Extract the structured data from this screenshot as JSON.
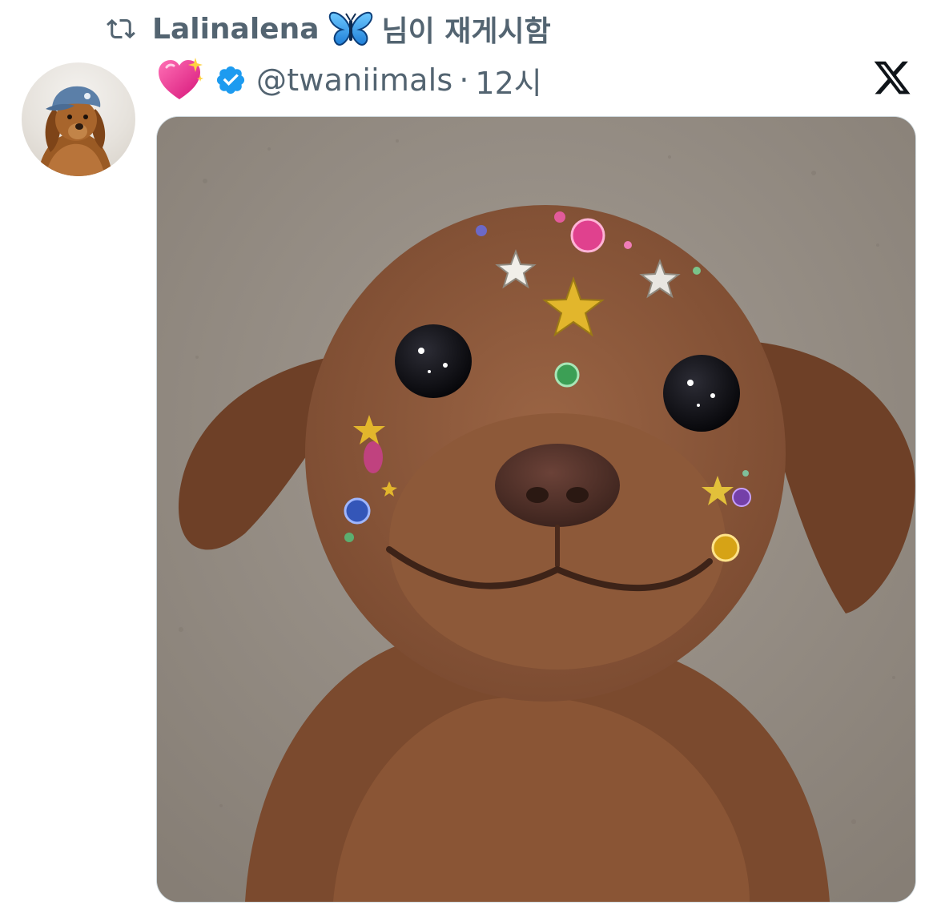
{
  "retweet": {
    "icon": "retweet-icon",
    "user": "Lalinalena",
    "emoji": "butterfly-emoji",
    "suffix": "님이 재게시함"
  },
  "author": {
    "avatar": "dog-avatar",
    "name_emoji": "sparkling-heart-emoji",
    "verified": true,
    "handle": "@twaniimals",
    "separator": "·",
    "time": "12시"
  },
  "brand": {
    "logo": "x-logo",
    "color": "#0f1419"
  },
  "colors": {
    "secondary_text": "#536471",
    "verified_blue": "#1d9bf0",
    "border": "#cfd9de"
  },
  "media": {
    "type": "photo",
    "subject": "puppy-with-face-gems"
  }
}
